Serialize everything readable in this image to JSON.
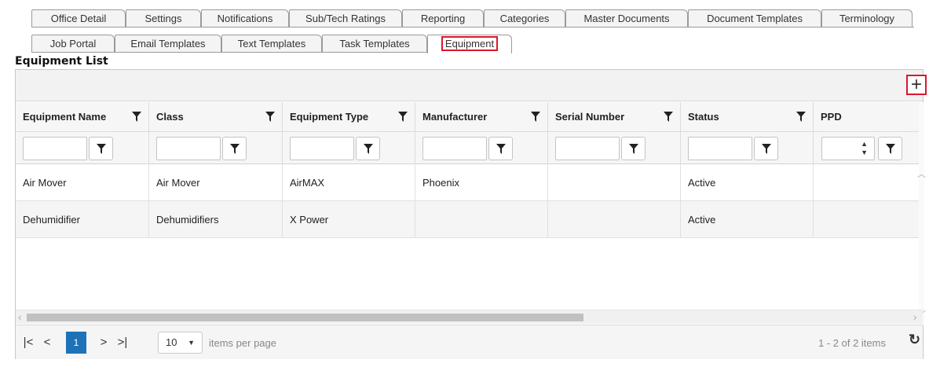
{
  "tabs_row1": [
    "Office Detail",
    "Settings",
    "Notifications",
    "Sub/Tech Ratings",
    "Reporting",
    "Categories",
    "Master Documents",
    "Document Templates",
    "Terminology"
  ],
  "tabs_row2": [
    "Job Portal",
    "Email Templates",
    "Text Templates",
    "Task Templates",
    "Equipment"
  ],
  "active_tab": "Equipment",
  "section_title": "Equipment List",
  "toolbar": {
    "add_icon": "plus-icon"
  },
  "columns": [
    "Equipment Name",
    "Class",
    "Equipment Type",
    "Manufacturer",
    "Serial Number",
    "Status",
    "PPD"
  ],
  "rows": [
    [
      "Air Mover",
      "Air Mover",
      "AirMAX",
      "Phoenix",
      "",
      "Active",
      ""
    ],
    [
      "Dehumidifier",
      "Dehumidifiers",
      "X Power",
      "",
      "",
      "Active",
      ""
    ]
  ],
  "pager": {
    "current_page": "1",
    "page_size": "10",
    "per_page_label": "items per page",
    "count_label": "1 - 2 of 2 items"
  },
  "colors": {
    "highlight": "#d9182e",
    "active_page": "#1d72b8"
  }
}
